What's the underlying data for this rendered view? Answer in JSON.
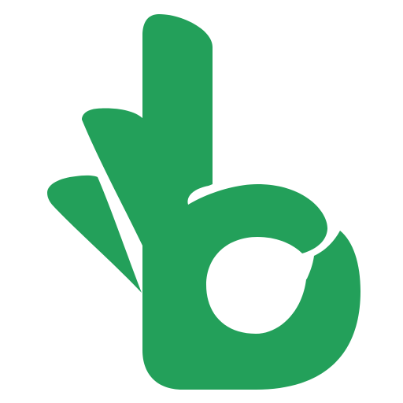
{
  "logo": {
    "icon": "ok-hand-b-logo-icon",
    "colors": {
      "mark": "#23A05A",
      "background": "#FFFFFF"
    }
  }
}
